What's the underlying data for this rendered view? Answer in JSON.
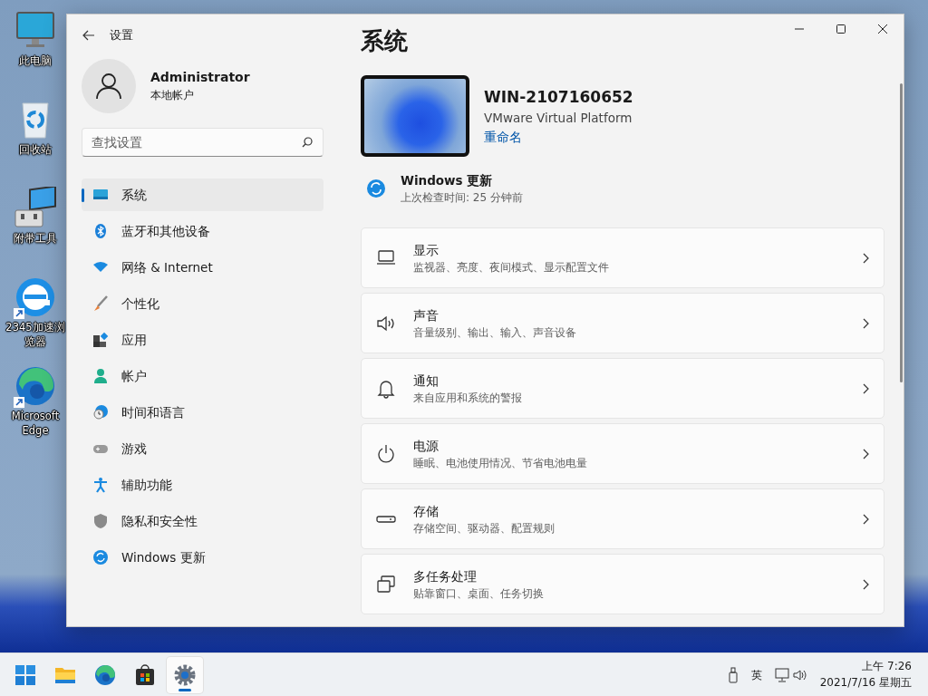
{
  "desktop_icons": [
    {
      "label": "此电脑",
      "kind": "pc",
      "shortcut": false
    },
    {
      "label": "回收站",
      "kind": "bin",
      "shortcut": false
    },
    {
      "label": "附带工具",
      "kind": "tools",
      "shortcut": false
    },
    {
      "label": "2345加速浏览器",
      "kind": "ie",
      "shortcut": true
    },
    {
      "label": "Microsoft Edge",
      "kind": "edge",
      "shortcut": true
    }
  ],
  "window": {
    "title": "设置",
    "account": {
      "name": "Administrator",
      "type": "本地帐户"
    },
    "search": {
      "placeholder": "查找设置"
    },
    "sidebar": {
      "items": [
        {
          "label": "系统",
          "selected": true
        },
        {
          "label": "蓝牙和其他设备",
          "selected": false
        },
        {
          "label": "网络 & Internet",
          "selected": false
        },
        {
          "label": "个性化",
          "selected": false
        },
        {
          "label": "应用",
          "selected": false
        },
        {
          "label": "帐户",
          "selected": false
        },
        {
          "label": "时间和语言",
          "selected": false
        },
        {
          "label": "游戏",
          "selected": false
        },
        {
          "label": "辅助功能",
          "selected": false
        },
        {
          "label": "隐私和安全性",
          "selected": false
        },
        {
          "label": "Windows 更新",
          "selected": false
        }
      ]
    },
    "page_title": "系统",
    "device": {
      "name": "WIN-2107160652",
      "model": "VMware Virtual Platform",
      "rename_link": "重命名"
    },
    "update": {
      "title": "Windows 更新",
      "status": "上次检查时间: 25 分钟前"
    },
    "cards": [
      {
        "title": "显示",
        "description": "监视器、亮度、夜间模式、显示配置文件"
      },
      {
        "title": "声音",
        "description": "音量级别、输出、输入、声音设备"
      },
      {
        "title": "通知",
        "description": "来自应用和系统的警报"
      },
      {
        "title": "电源",
        "description": "睡眠、电池使用情况、节省电池电量"
      },
      {
        "title": "存储",
        "description": "存储空间、驱动器、配置规则"
      },
      {
        "title": "多任务处理",
        "description": "贴靠窗口、桌面、任务切换"
      }
    ]
  },
  "taskbar": {
    "apps": [
      {
        "kind": "start",
        "selected": false
      },
      {
        "kind": "explorer",
        "selected": false
      },
      {
        "kind": "edge",
        "selected": false
      },
      {
        "kind": "store",
        "selected": false
      },
      {
        "kind": "settings",
        "selected": true
      }
    ],
    "input_method": "英",
    "time": "上午 7:26",
    "date": "2021/7/16 星期五"
  }
}
